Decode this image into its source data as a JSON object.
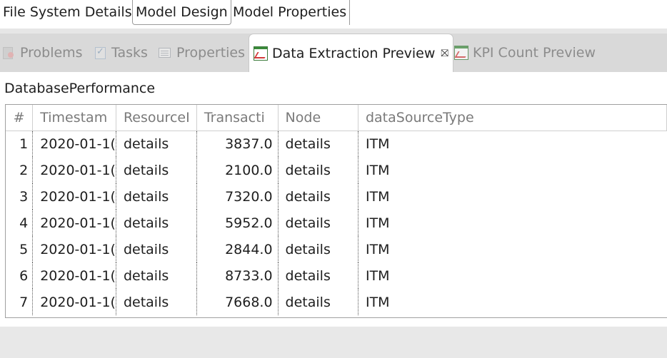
{
  "editor_tabs": [
    {
      "label": "File System Details"
    },
    {
      "label": "Model Design"
    },
    {
      "label": "Model Properties"
    }
  ],
  "view_tabs": [
    {
      "label": "Problems",
      "icon": "problems-icon"
    },
    {
      "label": "Tasks",
      "icon": "tasks-icon"
    },
    {
      "label": "Properties",
      "icon": "properties-icon"
    },
    {
      "label": "Data Extraction Preview",
      "icon": "chart-icon",
      "active": true
    },
    {
      "label": "KPI Count Preview",
      "icon": "chart-icon"
    }
  ],
  "close_glyph": "⛝",
  "panel": {
    "title": "DatabasePerformance",
    "columns": [
      "#",
      "Timestam",
      "ResourceI",
      "Transacti",
      "Node",
      "dataSourceType"
    ],
    "rows": [
      [
        "1",
        "2020-01-1(",
        "details",
        "3837.0",
        "details",
        "ITM"
      ],
      [
        "2",
        "2020-01-1(",
        "details",
        "2100.0",
        "details",
        "ITM"
      ],
      [
        "3",
        "2020-01-1(",
        "details",
        "7320.0",
        "details",
        "ITM"
      ],
      [
        "4",
        "2020-01-1(",
        "details",
        "5952.0",
        "details",
        "ITM"
      ],
      [
        "5",
        "2020-01-1(",
        "details",
        "2844.0",
        "details",
        "ITM"
      ],
      [
        "6",
        "2020-01-1(",
        "details",
        "8733.0",
        "details",
        "ITM"
      ],
      [
        "7",
        "2020-01-1(",
        "details",
        "7668.0",
        "details",
        "ITM"
      ]
    ]
  }
}
